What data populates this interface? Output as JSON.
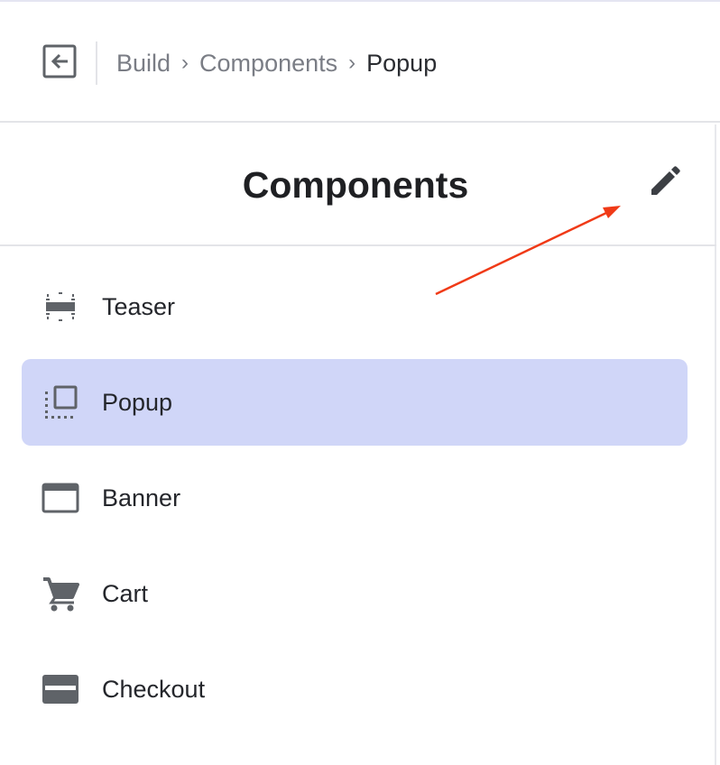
{
  "breadcrumb": {
    "items": [
      "Build",
      "Components"
    ],
    "separator": "›",
    "current": "Popup"
  },
  "panel": {
    "title": "Components"
  },
  "components": [
    {
      "label": "Teaser",
      "icon": "teaser-icon",
      "active": false
    },
    {
      "label": "Popup",
      "icon": "popup-icon",
      "active": true
    },
    {
      "label": "Banner",
      "icon": "banner-icon",
      "active": false
    },
    {
      "label": "Cart",
      "icon": "cart-icon",
      "active": false
    },
    {
      "label": "Checkout",
      "icon": "credit-card-icon",
      "active": false
    }
  ],
  "colors": {
    "active_bg": "#d0d6f8",
    "icon": "#5f6368",
    "annotation_arrow": "#f03a17"
  }
}
